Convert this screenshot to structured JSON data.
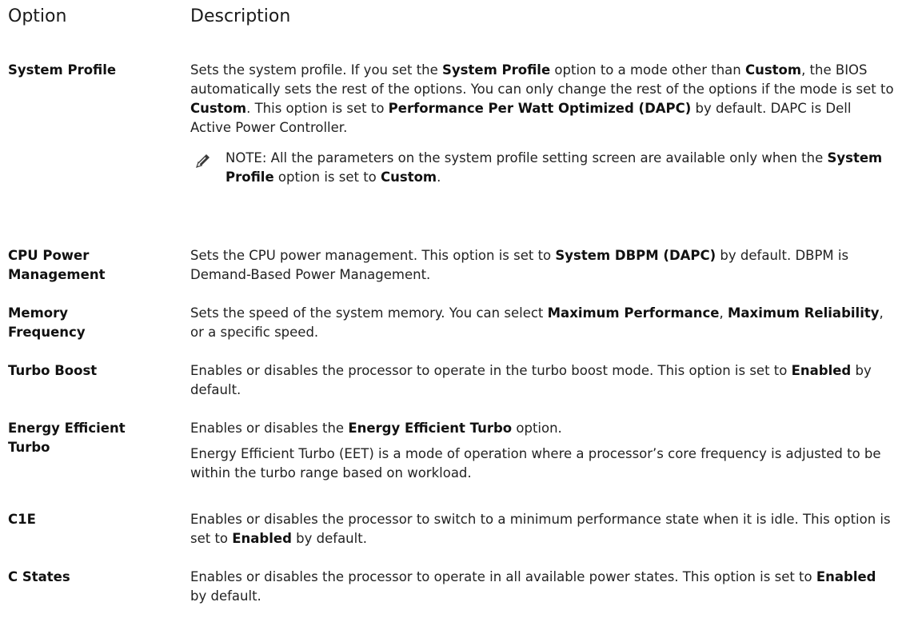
{
  "header": {
    "option": "Option",
    "description": "Description"
  },
  "rows": [
    {
      "name": "System Profile",
      "paragraphs": [
        [
          {
            "t": "Sets the system profile. If you set the "
          },
          {
            "t": "System Profile",
            "b": true
          },
          {
            "t": " option to a mode other than "
          },
          {
            "t": "Custom",
            "b": true
          },
          {
            "t": ", the BIOS automatically sets the rest of the options. You can only change the rest of the options if the mode is set to "
          },
          {
            "t": "Custom",
            "b": true
          },
          {
            "t": ". This option is set to "
          },
          {
            "t": "Performance Per Watt Optimized (DAPC)",
            "b": true
          },
          {
            "t": " by default. DAPC is Dell Active Power Controller."
          }
        ]
      ],
      "note": {
        "label": "NOTE:",
        "icon": "pencil-icon",
        "segments": [
          {
            "t": " All the parameters on the system profile setting screen are available only when the "
          },
          {
            "t": "System Profile",
            "b": true
          },
          {
            "t": " option is set to "
          },
          {
            "t": "Custom",
            "b": true
          },
          {
            "t": "."
          }
        ]
      }
    },
    {
      "name": "CPU Power Management",
      "paragraphs": [
        [
          {
            "t": "Sets the CPU power management. This option is set to "
          },
          {
            "t": "System DBPM (DAPC)",
            "b": true
          },
          {
            "t": " by default. DBPM is Demand-Based Power Management."
          }
        ]
      ]
    },
    {
      "name": "Memory Frequency",
      "paragraphs": [
        [
          {
            "t": "Sets the speed of the system memory. You can select "
          },
          {
            "t": "Maximum Performance",
            "b": true
          },
          {
            "t": ", "
          },
          {
            "t": "Maximum Reliability",
            "b": true
          },
          {
            "t": ", or a specific speed."
          }
        ]
      ]
    },
    {
      "name": "Turbo Boost",
      "paragraphs": [
        [
          {
            "t": "Enables or disables the processor to operate in the turbo boost mode. This option is set to "
          },
          {
            "t": "Enabled",
            "b": true
          },
          {
            "t": " by default."
          }
        ]
      ]
    },
    {
      "name": "Energy Efficient Turbo",
      "paragraphs": [
        [
          {
            "t": "Enables or disables the "
          },
          {
            "t": "Energy Efficient Turbo",
            "b": true
          },
          {
            "t": " option."
          }
        ],
        [
          {
            "t": "Energy Efficient Turbo (EET) is a mode of operation where a processor’s core frequency is adjusted to be within the turbo range based on workload."
          }
        ]
      ]
    },
    {
      "name": "C1E",
      "paragraphs": [
        [
          {
            "t": "Enables or disables the processor to switch to a minimum performance state when it is idle. This option is set to "
          },
          {
            "t": "Enabled",
            "b": true
          },
          {
            "t": " by default."
          }
        ]
      ]
    },
    {
      "name": "C States",
      "paragraphs": [
        [
          {
            "t": "Enables or disables the processor to operate in all available power states. This option is set to "
          },
          {
            "t": "Enabled",
            "b": true
          },
          {
            "t": " by default."
          }
        ]
      ]
    }
  ]
}
